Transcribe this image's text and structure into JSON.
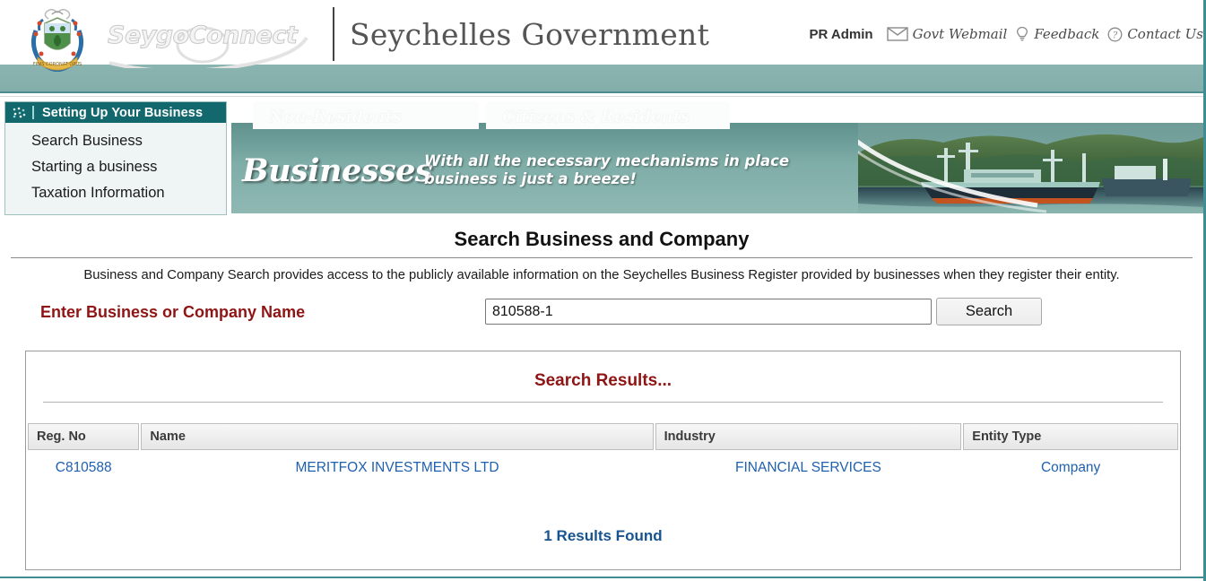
{
  "header": {
    "brand_name": "SeygoConnect",
    "site_title": "Seychelles Government",
    "user": "PR Admin",
    "links": [
      {
        "label": "Govt Webmail",
        "icon": "envelope-icon"
      },
      {
        "label": "Feedback",
        "icon": "lightbulb-icon"
      },
      {
        "label": "Contact Us",
        "icon": "question-circle-icon"
      }
    ],
    "crest_alt": "seychelles-coat-of-arms"
  },
  "sidebar": {
    "title": "Setting Up Your Business",
    "items": [
      {
        "label": "Search Business"
      },
      {
        "label": "Starting a business"
      },
      {
        "label": "Taxation Information"
      }
    ]
  },
  "banner": {
    "tabs": [
      {
        "label": "Non-Residents"
      },
      {
        "label": "Citizens & Residents"
      }
    ],
    "headline": "Businesses",
    "tagline_line1": "With all the necessary mechanisms in place",
    "tagline_line2": "business is just a breeze!",
    "photo_alt": "harbour-ships-photo"
  },
  "main": {
    "page_title": "Search Business and Company",
    "intro": "Business and Company Search provides access to the publicly available information on the Seychelles Business Register provided by businesses when they register their entity.",
    "search": {
      "label": "Enter Business or Company Name",
      "value": "810588-1",
      "placeholder": "",
      "button_label": "Search"
    },
    "results": {
      "title": "Search Results...",
      "columns": [
        "Reg. No",
        "Name",
        "Industry",
        "Entity Type"
      ],
      "rows": [
        {
          "reg_no": "C810588",
          "name": "MERITFOX INVESTMENTS LTD",
          "industry": "FINANCIAL SERVICES",
          "entity_type": "Company"
        }
      ],
      "count_text": "1 Results Found"
    }
  },
  "colors": {
    "teal_bar": "#85afac",
    "sidebar_header": "#12686d",
    "accent_maroon": "#8f1515",
    "link_blue": "#2060b0",
    "count_blue": "#17548f",
    "page_border": "#3f8d92"
  }
}
